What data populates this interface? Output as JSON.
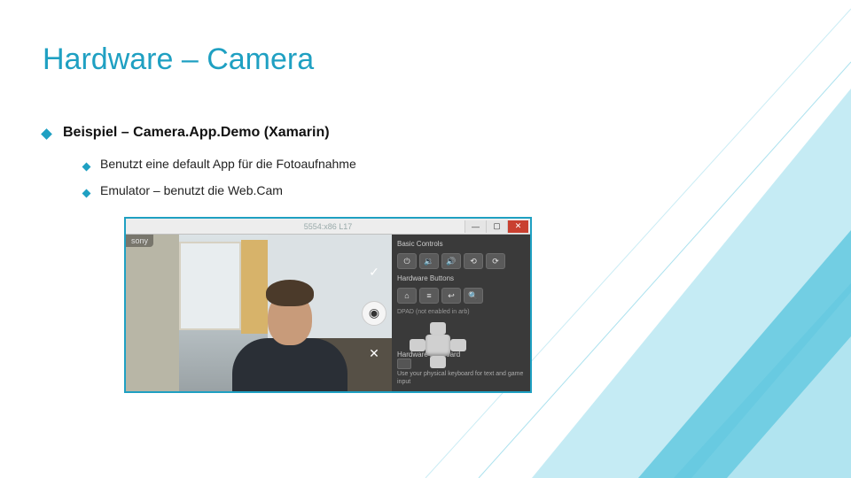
{
  "slide": {
    "title": "Hardware – Camera",
    "bullet1": "Beispiel – Camera.App.Demo (Xamarin)",
    "sub1": "Benutzt eine default App für die Fotoaufnahme",
    "sub2": "Emulator – benutzt die Web.Cam"
  },
  "emulator": {
    "titlebar_center": "5554:x86 L17",
    "left_overlay": "sony",
    "panel": {
      "basic_controls": "Basic Controls",
      "dpad_label": "DPAD (not enabled in arb)",
      "hw_buttons_label": "Hardware Buttons",
      "kb_label": "Hardware Keyboard",
      "kb_sub": "Use your physical keyboard for text and game input"
    }
  },
  "icons": {
    "check": "✓",
    "camera": "◉",
    "cross": "✕",
    "power": "⏻",
    "vol_up": "🔊",
    "vol_down": "🔉",
    "rotate_l": "⟲",
    "rotate_r": "⟳",
    "home": "⌂",
    "menu": "≡",
    "back": "↩",
    "search": "🔍",
    "min": "—",
    "max": "▢",
    "close": "✕"
  }
}
